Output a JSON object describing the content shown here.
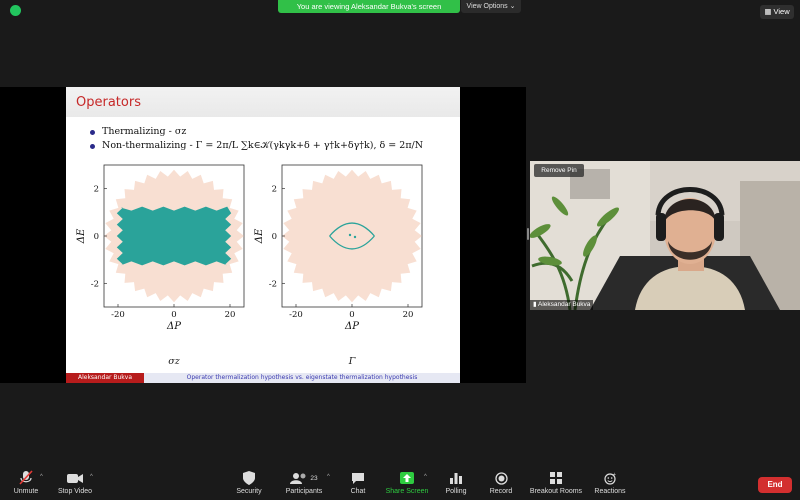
{
  "meeting": {
    "banner": "You are viewing Aleksandar Bukva's screen",
    "view_options": "View Options ⌄",
    "view_button": "View",
    "remove_pin": "Remove Pin",
    "participant_name": "Aleksandar Bukva"
  },
  "slide": {
    "title": "Operators",
    "bullet1": "Thermalizing - σz",
    "bullet2": "Non-thermalizing - Γ = 2π/L ∑k∈𝒦(γkγk+δ + γ†k+δγ†k), δ = 2π/N",
    "footer_left": "Aleksandar Bukva",
    "footer_right": "Operator thermalization hypothesis vs. eigenstate thermalization hypothesis",
    "plot_left_caption": "σz",
    "plot_right_caption": "Γ",
    "xlabel": "ΔP",
    "ylabel": "ΔE",
    "xticks": [
      "-20",
      "0",
      "20"
    ],
    "yticks": [
      "2",
      "0",
      "-2"
    ]
  },
  "chart_data": [
    {
      "type": "scatter",
      "caption": "σz",
      "xlabel": "ΔP",
      "ylabel": "ΔE",
      "xlim": [
        -25,
        25
      ],
      "ylim": [
        -3,
        3
      ],
      "series": [
        {
          "color": "#f8dfd2",
          "shape": "spiky disk",
          "radius_x": 25,
          "radius_y": 2.8
        },
        {
          "color": "#2aa39a",
          "shape": "band",
          "x_range": [
            -19,
            19
          ],
          "y_range": [
            -1.2,
            1.2
          ]
        }
      ]
    },
    {
      "type": "scatter",
      "caption": "Γ",
      "xlabel": "ΔP",
      "ylabel": "ΔE",
      "xlim": [
        -25,
        25
      ],
      "ylim": [
        -3,
        3
      ],
      "series": [
        {
          "color": "#f8dfd2",
          "shape": "spiky disk",
          "radius_x": 25,
          "radius_y": 2.8
        },
        {
          "color": "#2aa39a",
          "shape": "lens outline",
          "x_range": [
            -8,
            8
          ],
          "y_range": [
            -0.5,
            0.5
          ]
        }
      ]
    }
  ],
  "toolbar": {
    "unmute": "Unmute",
    "stop_video": "Stop Video",
    "security": "Security",
    "participants": "Participants",
    "participants_count": "23",
    "chat": "Chat",
    "share_screen": "Share Screen",
    "polling": "Polling",
    "record": "Record",
    "breakout_rooms": "Breakout Rooms",
    "reactions": "Reactions",
    "end": "End"
  },
  "colors": {
    "banner_green": "#31c048",
    "slide_title_red": "#c62828",
    "end_red": "#d32f2f",
    "teal": "#2aa39a",
    "peach": "#f8dfd2"
  }
}
